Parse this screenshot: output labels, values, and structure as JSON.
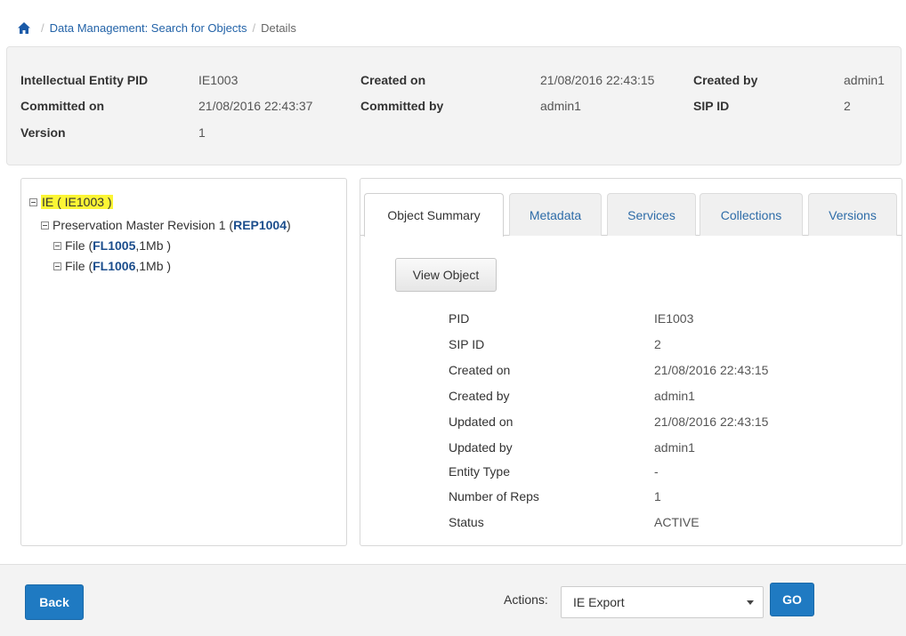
{
  "breadcrumb": {
    "home_icon": "home-icon",
    "link": "Data Management: Search for Objects",
    "current": "Details"
  },
  "header": {
    "ie_pid_label": "Intellectual Entity PID",
    "ie_pid_value": "IE1003",
    "created_on_label": "Created on",
    "created_on_value": "21/08/2016 22:43:15",
    "created_by_label": "Created by",
    "created_by_value": "admin1",
    "committed_on_label": "Committed on",
    "committed_on_value": "21/08/2016 22:43:37",
    "committed_by_label": "Committed by",
    "committed_by_value": "admin1",
    "sip_id_label": "SIP ID",
    "sip_id_value": "2",
    "version_label": "Version",
    "version_value": "1"
  },
  "tree": {
    "ie": {
      "text": "IE ( IE1003 )"
    },
    "rep": {
      "prefix": "Preservation Master Revision 1 ( ",
      "id": "REP1004",
      "suffix": " )"
    },
    "files": [
      {
        "prefix": "File ( ",
        "id": "FL1005",
        "suffix": " ,1Mb )"
      },
      {
        "prefix": "File ( ",
        "id": "FL1006",
        "suffix": " ,1Mb )"
      }
    ]
  },
  "tabs": [
    "Object Summary",
    "Metadata",
    "Services",
    "Collections",
    "Versions"
  ],
  "view_object_label": "View Object",
  "properties": [
    {
      "label": "PID",
      "value": "IE1003"
    },
    {
      "label": "SIP ID",
      "value": "2"
    },
    {
      "label": "Created on",
      "value": "21/08/2016 22:43:15"
    },
    {
      "label": "Created by",
      "value": "admin1"
    },
    {
      "label": "Updated on",
      "value": "21/08/2016 22:43:15"
    },
    {
      "label": "Updated by",
      "value": "admin1"
    },
    {
      "label": "Entity Type",
      "value": "-"
    },
    {
      "label": "Number of Reps",
      "value": "1"
    },
    {
      "label": "Status",
      "value": "ACTIVE"
    }
  ],
  "footer": {
    "back_label": "Back",
    "actions_label": "Actions:",
    "actions_selected": "IE Export",
    "go_label": "GO"
  },
  "colors": {
    "primary_button": "#1f7ac2",
    "link": "#2363a8",
    "highlight": "#fcf535"
  }
}
